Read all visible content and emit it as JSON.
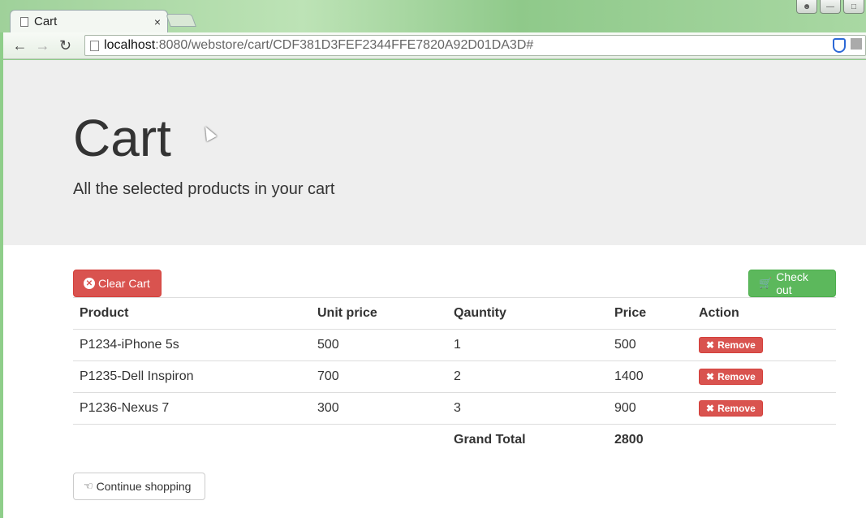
{
  "browser": {
    "tab_title": "Cart",
    "tab_close": "×",
    "url_host": "localhost",
    "url_rest": ":8080/webstore/cart/CDF381D3FEF2344FFE7820A92D01DA3D#"
  },
  "jumbotron": {
    "title": "Cart",
    "subtitle": "All the selected products in your cart"
  },
  "actions": {
    "clear_label": "Clear Cart",
    "checkout_label": "Check out",
    "continue_label": "Continue shopping"
  },
  "table": {
    "headers": [
      "Product",
      "Unit price",
      "Qauntity",
      "Price",
      "Action"
    ],
    "rows": [
      {
        "product": "P1234-iPhone 5s",
        "unit_price": "500",
        "quantity": "1",
        "price": "500",
        "action": "Remove"
      },
      {
        "product": "P1235-Dell Inspiron",
        "unit_price": "700",
        "quantity": "2",
        "price": "1400",
        "action": "Remove"
      },
      {
        "product": "P1236-Nexus 7",
        "unit_price": "300",
        "quantity": "3",
        "price": "900",
        "action": "Remove"
      }
    ],
    "grand_total_label": "Grand Total",
    "grand_total_value": "2800"
  },
  "colors": {
    "danger": "#d9534f",
    "success": "#5cb85c",
    "jumbotron_bg": "#eeeeee"
  }
}
